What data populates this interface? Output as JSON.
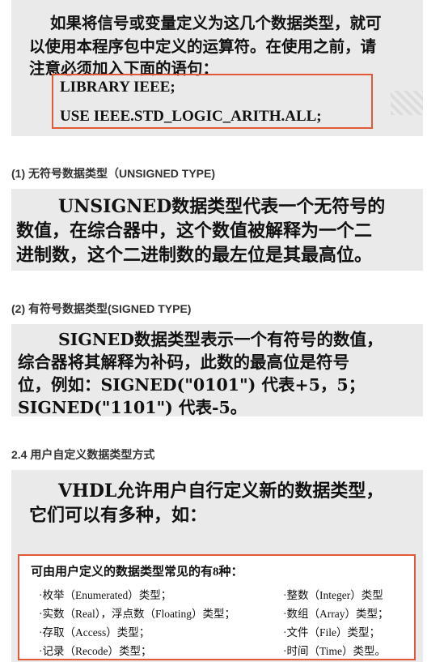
{
  "block1": {
    "line1": "如果将信号或变量定义为这几个数据类型，就可",
    "line2": "以使用本程序包中定义的运算符。在使用之前，请",
    "line3": "注意必须加入下面的语句：",
    "code1": "LIBRARY IEEE;",
    "code2": "USE IEEE.STD_LOGIC_ARITH.ALL;"
  },
  "heading1": "(1) 无符号数据类型（UNSIGNED TYPE)",
  "block2": {
    "line1": "UNSIGNED数据类型代表一个无符号的",
    "line2": "数值，在综合器中，这个数值被解释为一个二",
    "line3": "进制数，这个二进制数的最左位是其最高位。"
  },
  "heading2": "(2) 有符号数据类型(SIGNED TYPE)",
  "block3": {
    "line1": "SIGNED数据类型表示一个有符号的数值，",
    "line2": "综合器将其解释为补码，此数的最高位是符号",
    "line3": "位，例如：SIGNED(\"0101\") 代表+5，5；",
    "line4": "SIGNED(\"1101\") 代表-5。"
  },
  "heading3": "2.4 用户自定义数据类型方式",
  "block4": {
    "line1": "VHDL允许用户自行定义新的数据类型，",
    "line2": "它们可以有多种，如：",
    "box_title": "可由用户定义的数据类型常见的有8种：",
    "types": [
      "·枚举（Enumerated）类型；",
      "·整数（Integer）类型",
      "·实数（Real），浮点数（Floating）类型；",
      "·数组（Array）类型；",
      "·存取（Access）类型；",
      "·文件（File）类型；",
      "·记录（Recode）类型；",
      "·时间（Time）类型。"
    ]
  }
}
